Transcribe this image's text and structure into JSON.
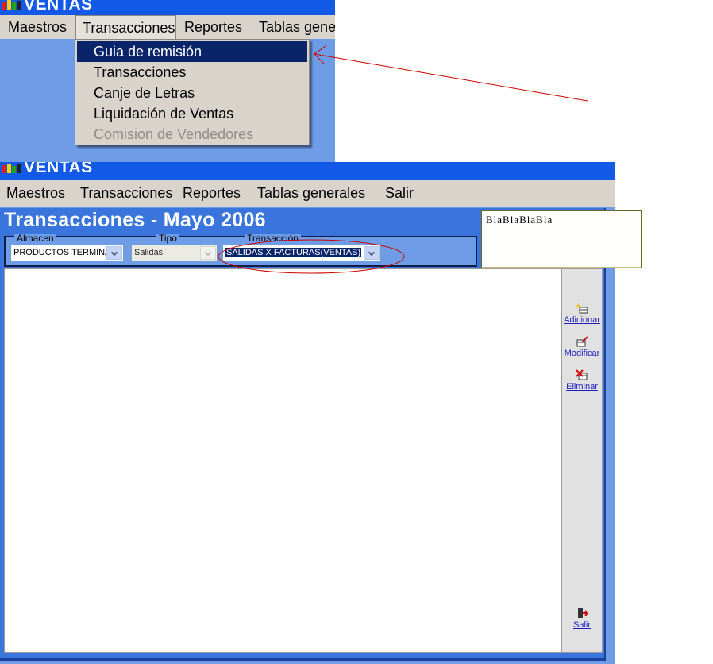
{
  "app": {
    "title": "VENTAS"
  },
  "top_crop": {
    "menu": [
      "Maestros",
      "Transacciones",
      "Reportes",
      "Tablas gene"
    ],
    "dropdown": [
      {
        "label": "Guia de remisión",
        "state": "selected"
      },
      {
        "label": "Transacciones",
        "state": "normal"
      },
      {
        "label": "Canje de Letras",
        "state": "normal"
      },
      {
        "label": "Liquidación de Ventas",
        "state": "normal"
      },
      {
        "label": "Comision de Vendedores",
        "state": "disabled"
      }
    ]
  },
  "main": {
    "menu": [
      "Maestros",
      "Transacciones",
      "Reportes",
      "Tablas generales",
      "Salir"
    ],
    "form_title": "Transacciones - Mayo 2006",
    "filters": {
      "almacen_label": "Almacen",
      "almacen_value": "PRODUCTOS TERMINA",
      "tipo_label": "Tipo",
      "tipo_value": "Salidas",
      "transaccion_label": "Transacción",
      "transaccion_value": "SALIDAS X FACTURAS(VENTAS)"
    },
    "toolbar": {
      "add_label": "Adicionar",
      "edit_label": "Modificar",
      "delete_label": "Eliminar",
      "exit_label": "Salir"
    }
  },
  "annotation": {
    "note_text": "BlaBlaBlaBla"
  },
  "colors": {
    "titlebar": "#1359e8",
    "background": "#6f9ce6",
    "selection": "#0a246a",
    "annotation": "#cc0000"
  }
}
